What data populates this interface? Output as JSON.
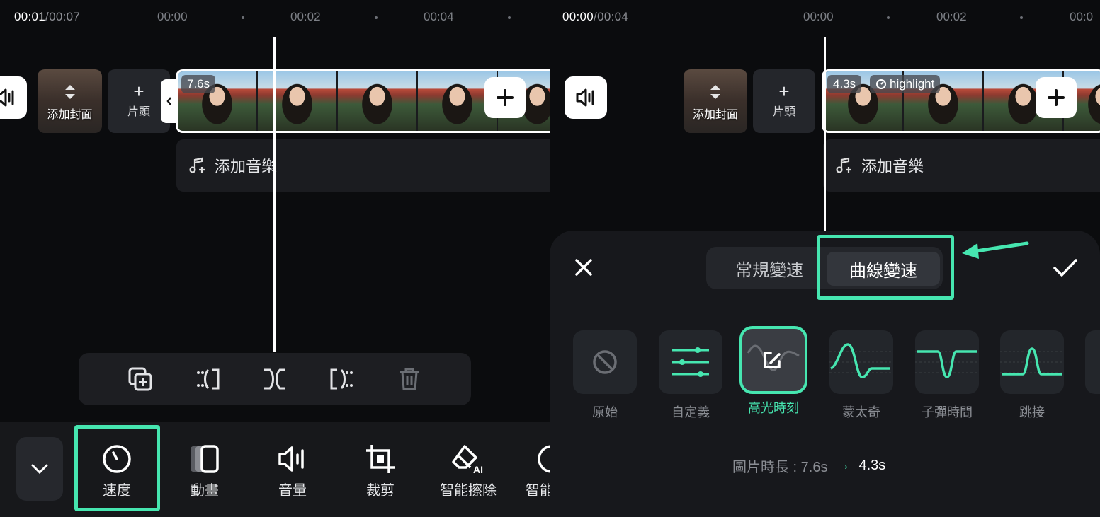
{
  "left": {
    "time": {
      "current": "00:01",
      "total": "/00:07"
    },
    "ruler": [
      "00:00",
      "00:02",
      "00:04"
    ],
    "cover_label": "添加封面",
    "head_label": "片頭",
    "clip_duration": "7.6s",
    "music_label": "添加音樂",
    "tools": [
      {
        "icon": "speedometer-icon",
        "label": "速度"
      },
      {
        "icon": "animation-icon",
        "label": "動畫"
      },
      {
        "icon": "volume-icon",
        "label": "音量"
      },
      {
        "icon": "crop-icon",
        "label": "裁剪"
      },
      {
        "icon": "ai-eraser-icon",
        "label": "智能擦除"
      },
      {
        "icon": "smart-icon",
        "label": "智能"
      }
    ]
  },
  "right": {
    "time": {
      "current": "00:00",
      "total": "/00:04"
    },
    "ruler": [
      "00:00",
      "00:02",
      "00:0"
    ],
    "cover_label": "添加封面",
    "head_label": "片頭",
    "clip_duration": "4.3s",
    "clip_tag": "highlight",
    "music_label": "添加音樂",
    "tabs": [
      "常規變速",
      "曲線變速"
    ],
    "presets": [
      {
        "icon": "no-icon",
        "label": "原始"
      },
      {
        "icon": "sliders-icon",
        "label": "自定義"
      },
      {
        "icon": "edit-curve-icon",
        "label": "高光時刻"
      },
      {
        "icon": "montage-curve-icon",
        "label": "蒙太奇"
      },
      {
        "icon": "bullet-time-curve-icon",
        "label": "子彈時間"
      },
      {
        "icon": "jump-cut-curve-icon",
        "label": "跳接"
      }
    ],
    "duration": {
      "label": "圖片時長 : 7.6s",
      "arrow": "→",
      "result": "4.3s"
    }
  },
  "colors": {
    "accent": "#46e6b0",
    "background": "#0b0c0e",
    "sheet": "#17181c"
  }
}
